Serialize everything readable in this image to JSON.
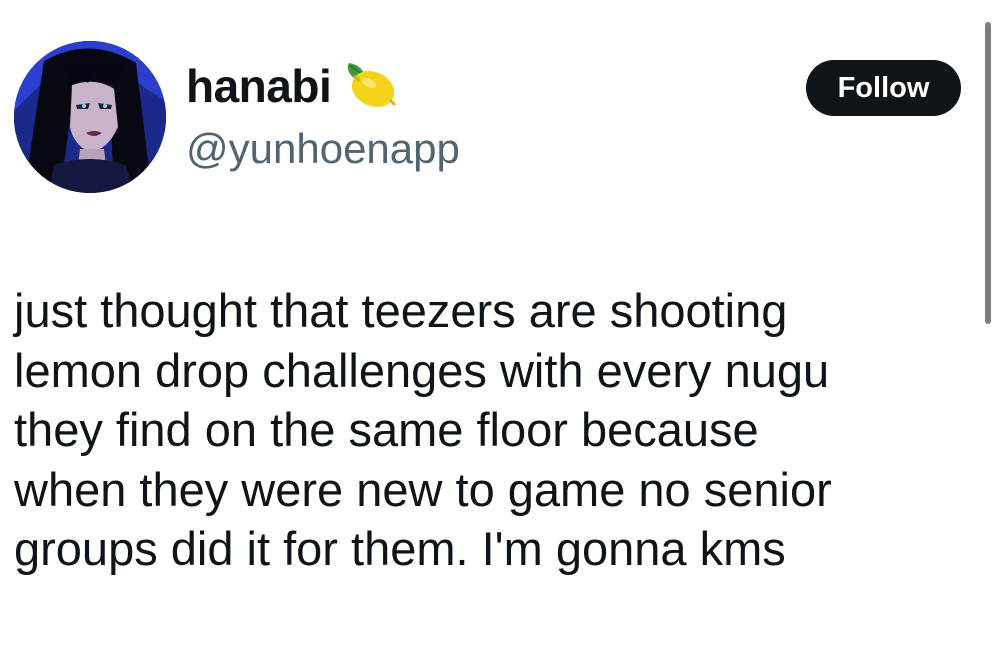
{
  "user": {
    "display_name": "hanabi",
    "display_name_emoji": "lemon-icon",
    "handle": "@yunhoenapp",
    "avatar": "avatar-illustration"
  },
  "actions": {
    "follow_label": "Follow"
  },
  "tweet": {
    "lines": [
      "just thought that teezers are shooting",
      "lemon drop challenges with every nugu",
      "they find on the same floor because",
      "when they were new to game no senior",
      "groups did it for them. I'm gonna kms"
    ]
  },
  "colors": {
    "text_primary": "#0f1419",
    "text_secondary": "#536471",
    "button_bg": "#0f1419",
    "button_text": "#ffffff",
    "background": "#ffffff"
  }
}
